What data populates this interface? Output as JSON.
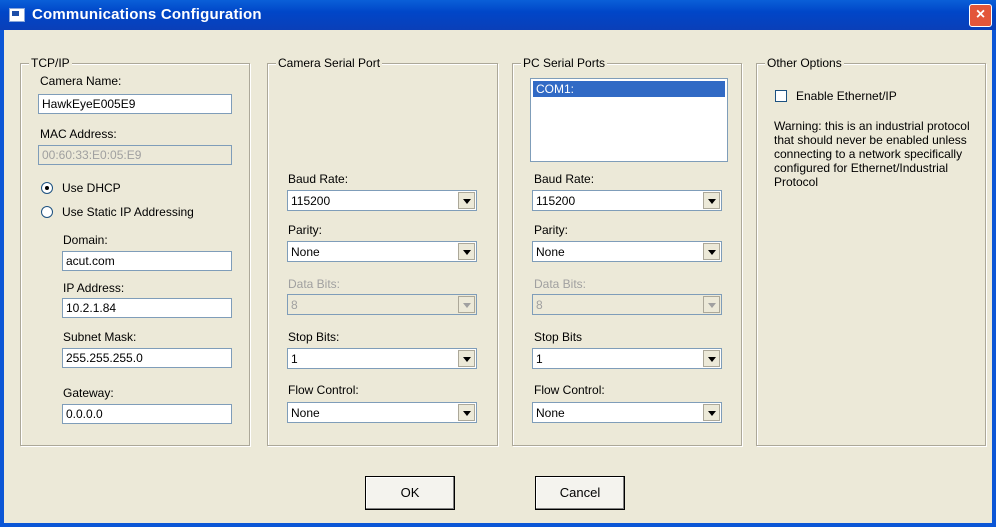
{
  "window": {
    "title": "Communications Configuration",
    "close_glyph": "×"
  },
  "tcpip": {
    "legend": "TCP/IP",
    "camera_name_label": "Camera Name:",
    "camera_name_value": "HawkEyeE005E9",
    "mac_label": "MAC Address:",
    "mac_value": "00:60:33:E0:05:E9",
    "use_dhcp_label": "Use DHCP",
    "use_static_label": "Use Static IP Addressing",
    "addressing_mode": "DHCP",
    "domain_label": "Domain:",
    "domain_value": "acut.com",
    "ip_label": "IP Address:",
    "ip_value": "10.2.1.84",
    "subnet_label": "Subnet Mask:",
    "subnet_value": "255.255.255.0",
    "gateway_label": "Gateway:",
    "gateway_value": "0.0.0.0"
  },
  "camera_serial": {
    "legend": "Camera Serial Port",
    "baud_label": "Baud Rate:",
    "baud_value": "115200",
    "parity_label": "Parity:",
    "parity_value": "None",
    "databits_label": "Data Bits:",
    "databits_value": "8",
    "stopbits_label": "Stop Bits:",
    "stopbits_value": "1",
    "flow_label": "Flow Control:",
    "flow_value": "None"
  },
  "pc_serial": {
    "legend": "PC Serial Ports",
    "ports": [
      "COM1:"
    ],
    "baud_label": "Baud Rate:",
    "baud_value": "115200",
    "parity_label": "Parity:",
    "parity_value": "None",
    "databits_label": "Data Bits:",
    "databits_value": "8",
    "stopbits_label": "Stop Bits",
    "stopbits_value": "1",
    "flow_label": "Flow Control:",
    "flow_value": "None"
  },
  "other": {
    "legend": "Other Options",
    "ethernet_ip_label": "Enable Ethernet/IP",
    "ethernet_ip_checked": false,
    "warning_text": "Warning: this is an industrial protocol that should never be enabled unless connecting to a network specifically configured for Ethernet/Industrial Protocol"
  },
  "buttons": {
    "ok": "OK",
    "cancel": "Cancel"
  },
  "colors": {
    "titlebar": "#0046c8",
    "dialog_bg": "#ece9d8",
    "selection": "#316ac5",
    "close": "#e3563a"
  }
}
